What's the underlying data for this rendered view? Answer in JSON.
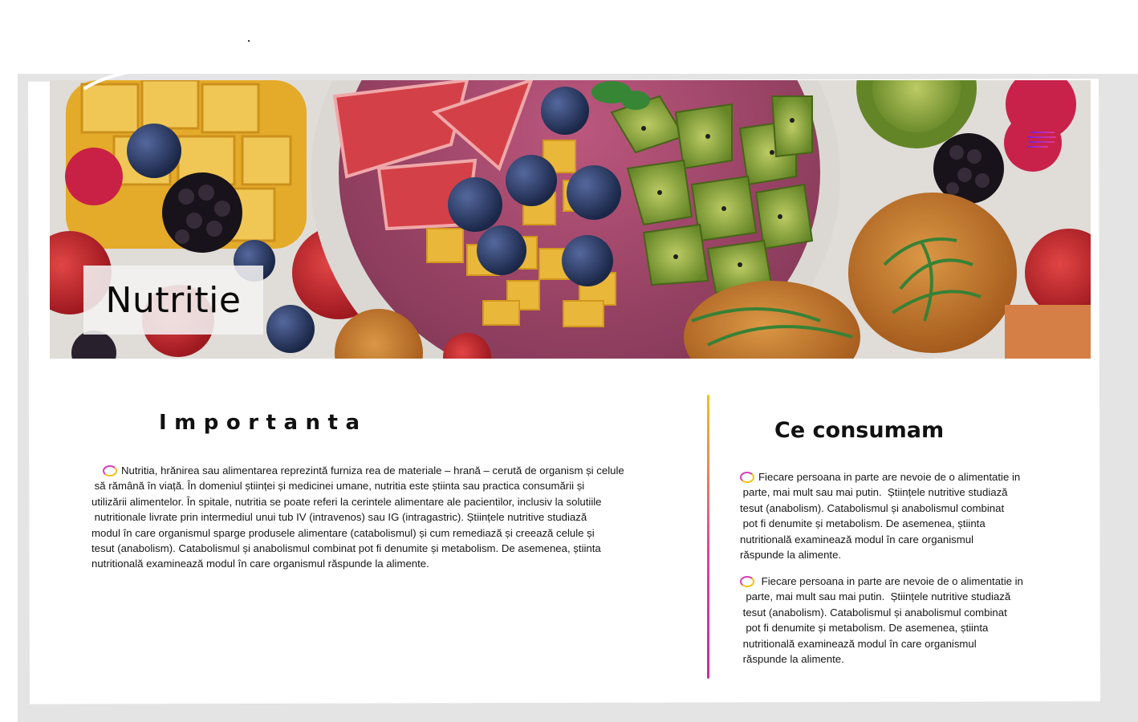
{
  "hero": {
    "title": "Nutritie",
    "menu_icon": "hamburger-menu-icon"
  },
  "importance": {
    "title": "Importanta",
    "bullet_icon": "ring-bullet-icon",
    "lines": [
      "Nutritia, hrănirea sau alimentarea reprezintă furniza rea de materiale – hrană – cerută de organism și celule",
      " să rămână în viață. În domeniul științei și medicinei umane, nutritia este știinta sau practica consumării și",
      "utilizării alimentelor. În spitale, nutritia se poate referi la cerintele alimentare ale pacientilor, inclusiv la solutiile",
      " nutritionale livrate prin intermediul unui tub IV (intravenos) sau IG (intragastric). Științele nutritive studiază",
      "modul în care organismul sparge produsele alimentare (catabolismul) și cum remediază și creează celule și",
      "tesut (anabolism). Catabolismul și anabolismul combinat pot fi denumite și metabolism. De asemenea, știinta",
      "nutritională examinează modul în care organismul răspunde la alimente."
    ]
  },
  "consumption": {
    "title": "Ce consumam",
    "paragraphs": [
      {
        "lines": [
          "Fiecare persoana in parte are nevoie de o alimentatie in",
          " parte, mai mult sau mai putin.  Științele nutritive studiază",
          "tesut (anabolism). Catabolismul și anabolismul combinat",
          " pot fi denumite și metabolism. De asemenea, știinta",
          "nutritională examinează modul în care organismul",
          "răspunde la alimente."
        ]
      },
      {
        "lines": [
          " Fiecare persoana in parte are nevoie de o alimentatie in",
          "  parte, mai mult sau mai putin.  Științele nutritive studiază",
          " tesut (anabolism). Catabolismul și anabolismul combinat",
          "  pot fi denumite și metabolism. De asemenea, știinta",
          " nutritională examinează modul în care organismul",
          " răspunde la alimente."
        ]
      }
    ]
  },
  "colors": {
    "accent_magenta": "#d640b8",
    "accent_yellow": "#f2c21a",
    "menu_gradient_start": "#7a1fd8",
    "text": "#161616"
  }
}
